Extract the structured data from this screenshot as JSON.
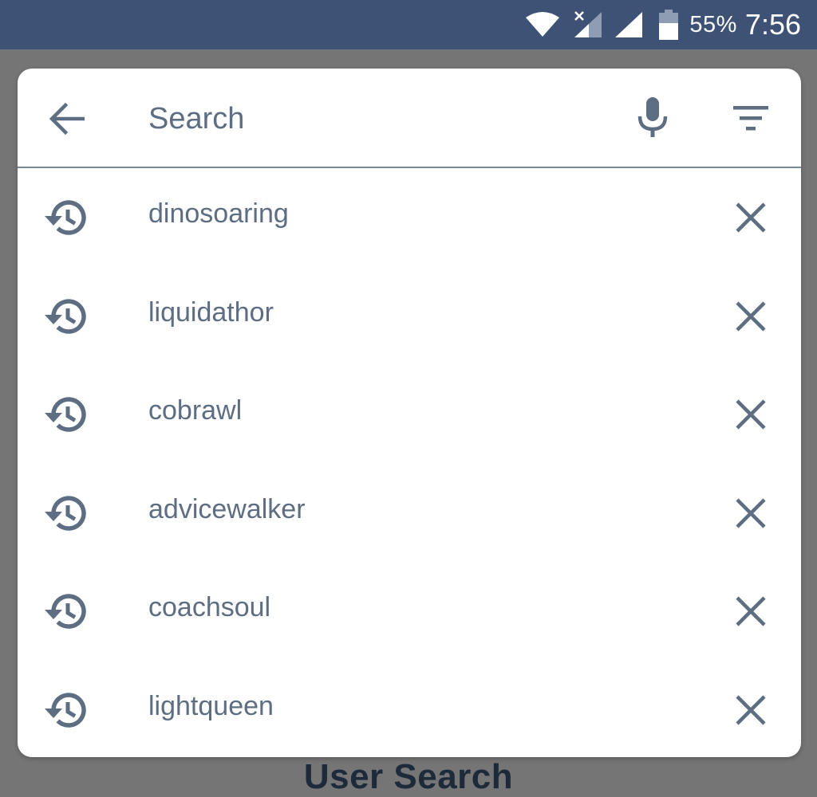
{
  "status_bar": {
    "battery_percent": "55%",
    "time": "7:56",
    "icons": [
      "wifi-icon",
      "signal-sim1-no-service-icon",
      "signal-sim2-icon",
      "battery-icon"
    ],
    "background_color": "#3e5276"
  },
  "search": {
    "placeholder": "Search",
    "value": "",
    "back_icon": "arrow-back-icon",
    "voice_icon": "microphone-icon",
    "filter_icon": "filter-icon"
  },
  "history": {
    "row_icon": "history-icon",
    "remove_icon": "close-icon",
    "items": [
      {
        "label": "dinosoaring"
      },
      {
        "label": "liquidathor"
      },
      {
        "label": "cobrawl"
      },
      {
        "label": "advicewalker"
      },
      {
        "label": "coachsoul"
      },
      {
        "label": "lightqueen"
      }
    ]
  },
  "background": {
    "partial_heading": "User Search"
  },
  "colors": {
    "icon": "#5d6d82",
    "text": "#5d6d82",
    "overlay": "#757575",
    "divider": "#7a8898"
  }
}
